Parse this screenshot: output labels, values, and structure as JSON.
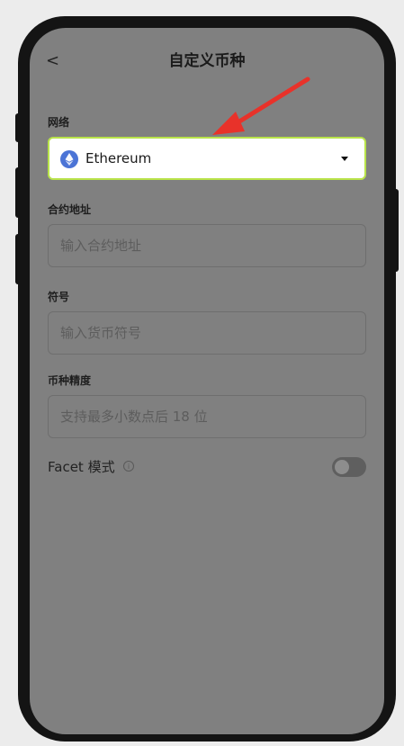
{
  "header": {
    "back_glyph": "<",
    "title": "自定义币种"
  },
  "form": {
    "network_label": "网络",
    "network_value": "Ethereum",
    "network_icon": "ethereum-icon",
    "contract_label": "合约地址",
    "contract_placeholder": "输入合约地址",
    "symbol_label": "符号",
    "symbol_placeholder": "输入货币符号",
    "precision_label": "币种精度",
    "precision_placeholder": "支持最多小数点后 18 位",
    "facet_label": "Facet 模式",
    "facet_info_glyph": "i",
    "facet_enabled": false
  },
  "colors": {
    "highlight_border": "#b9e34a",
    "annotation_arrow": "#e8322a",
    "eth_icon": "#4b74d6"
  }
}
